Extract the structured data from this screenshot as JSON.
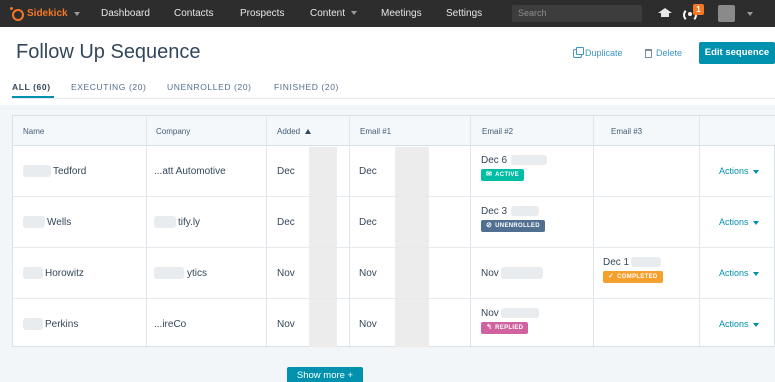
{
  "nav": {
    "brand": "Sidekick",
    "items": [
      "Dashboard",
      "Contacts",
      "Prospects",
      "Content",
      "Meetings",
      "Settings"
    ],
    "search_placeholder": "Search",
    "notification_count": "1"
  },
  "header": {
    "title": "Follow Up Sequence",
    "duplicate_label": "Duplicate",
    "delete_label": "Delete",
    "edit_label": "Edit sequence"
  },
  "tabs": [
    {
      "label": "ALL (60)"
    },
    {
      "label": "EXECUTING (20)"
    },
    {
      "label": "UNENROLLED (20)"
    },
    {
      "label": "FINISHED (20)"
    }
  ],
  "table": {
    "columns": [
      "Name",
      "Company",
      "Added",
      "Email #1",
      "Email #2",
      "Email #3"
    ],
    "rows": [
      {
        "name": "Tedford",
        "company": "...att Automotive",
        "added": "Dec",
        "email1": "Dec",
        "email2": "Dec 6",
        "email2_status": "ACTIVE",
        "email3": "",
        "email3_status": "",
        "actions": "Actions"
      },
      {
        "name": "Wells",
        "company": "tify.ly",
        "added": "Dec",
        "email1": "Dec",
        "email2": "Dec 3",
        "email2_status": "UNENROLLED",
        "email3": "",
        "email3_status": "",
        "actions": "Actions"
      },
      {
        "name": "Horowitz",
        "company": "ytics",
        "added": "Nov",
        "email1": "Nov",
        "email2": "Nov",
        "email2_status": "",
        "email3": "Dec 1",
        "email3_status": "COMPLETED",
        "actions": "Actions"
      },
      {
        "name": "Perkins",
        "company": "...ireCo",
        "added": "Nov",
        "email1": "Nov",
        "email2": "Nov",
        "email2_status": "REPLIED",
        "email3": "",
        "email3_status": "",
        "actions": "Actions"
      }
    ]
  },
  "footer": {
    "show_more_label": "Show more +"
  },
  "colors": {
    "accent": "#0091ae",
    "brand": "#f57722",
    "active": "#00bda5",
    "unenrolled": "#516f90",
    "completed": "#f5a02c",
    "replied": "#d0629f"
  },
  "icons": [
    "sidekick-logo-icon",
    "duplicate-icon",
    "trash-icon",
    "graduation-cap-icon",
    "signal-icon",
    "sort-up-icon"
  ]
}
